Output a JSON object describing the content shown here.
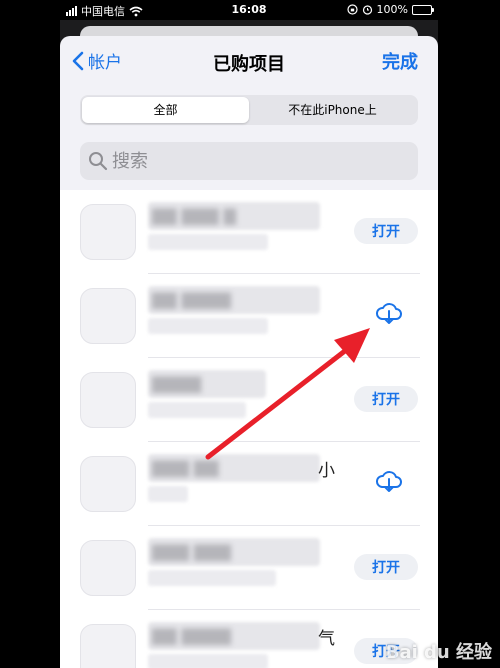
{
  "status_bar": {
    "carrier": "中国电信",
    "time": "16:08",
    "battery": "100%"
  },
  "nav": {
    "back_label": "帐户",
    "title": "已购项目",
    "done_label": "完成"
  },
  "segments": [
    {
      "label": "全部",
      "selected": true
    },
    {
      "label": "不在此iPhone上",
      "selected": false
    }
  ],
  "search": {
    "placeholder": "搜索"
  },
  "apps": [
    {
      "action": "open",
      "action_label": "打开",
      "visible_text": ""
    },
    {
      "action": "download",
      "action_label": "",
      "visible_text": ""
    },
    {
      "action": "open",
      "action_label": "打开",
      "visible_text": ""
    },
    {
      "action": "download",
      "action_label": "",
      "visible_text": "小"
    },
    {
      "action": "open",
      "action_label": "打开",
      "visible_text": ""
    },
    {
      "action": "open",
      "action_label": "打开",
      "visible_text": "气"
    }
  ],
  "watermark": {
    "text": "Bai du 经验"
  },
  "colors": {
    "accent": "#1a73e8",
    "arrow": "#e8202a"
  }
}
